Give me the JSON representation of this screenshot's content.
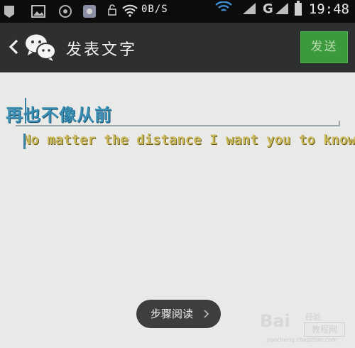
{
  "status_bar": {
    "speed": "0B/S",
    "time": "19:48",
    "network_label": "G",
    "icons": [
      "app-icon",
      "image-icon",
      "app-icon",
      "app-icon",
      "lock-icon",
      "wifi-icon",
      "wifi-icon",
      "signal-icon",
      "battery-icon"
    ]
  },
  "title_bar": {
    "title": "发表文字",
    "send_label": "发送",
    "colors": {
      "bar": "#2d2f31",
      "send": "#3b9a3b"
    }
  },
  "content": {
    "line1": "再也不像从前",
    "line2": "No matter the distance I want you to know"
  },
  "overlay": {
    "pill_label": "步骤阅读"
  },
  "watermark": {
    "logo": "Bai",
    "tag": "经验",
    "site": "教程网",
    "url": "jiaocheng.chazidian.com"
  }
}
